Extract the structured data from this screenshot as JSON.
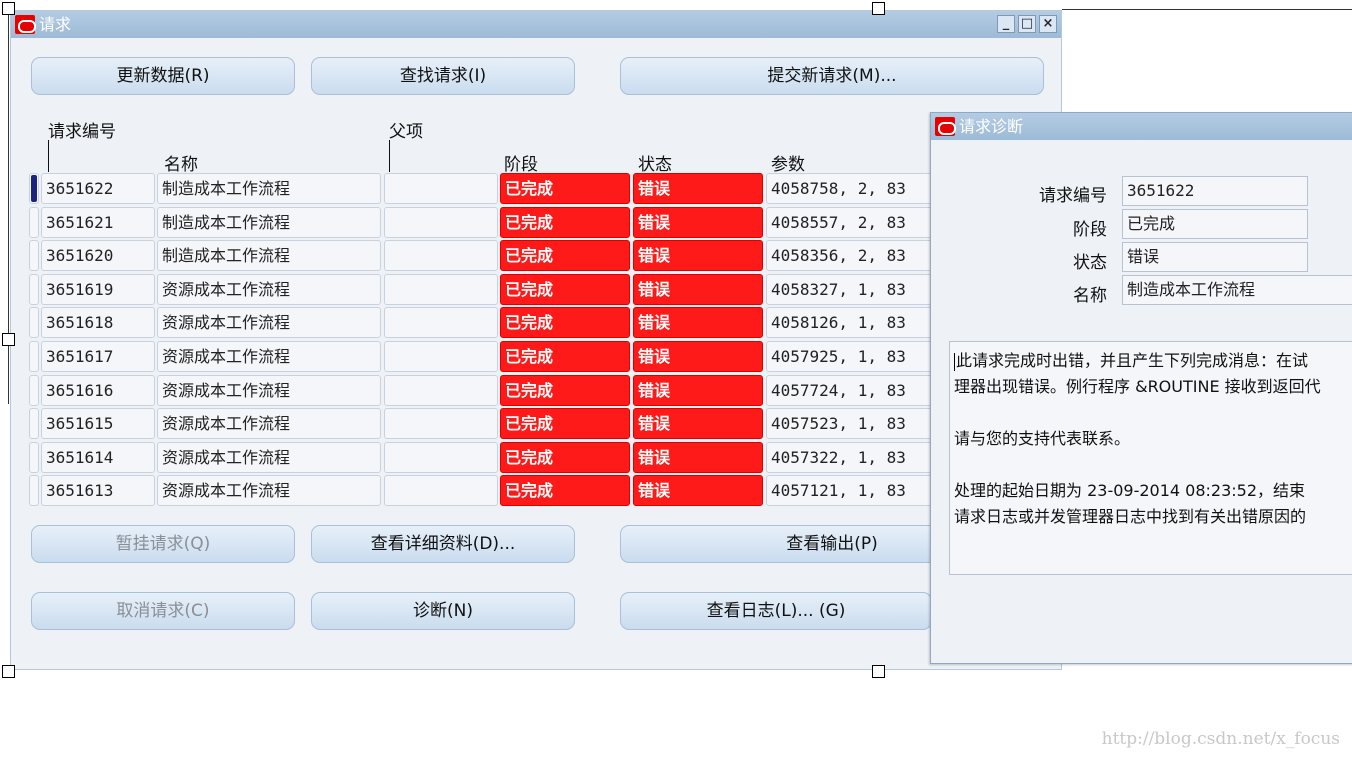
{
  "main_window": {
    "title": "请求",
    "win_buttons": {
      "minimize": "_",
      "maximize": "□",
      "close": "×"
    }
  },
  "toolbar": {
    "refresh_label": "更新数据(R)",
    "find_label": "查找请求(I)",
    "submit_label": "提交新请求(M)..."
  },
  "table": {
    "headers": {
      "request_id": "请求编号",
      "parent": "父项",
      "name": "名称",
      "phase": "阶段",
      "status": "状态",
      "params": "参数"
    },
    "rows": [
      {
        "id": "3651622",
        "name": "制造成本工作流程",
        "parent": "",
        "phase": "已完成",
        "status": "错误",
        "params": "4058758, 2, 83"
      },
      {
        "id": "3651621",
        "name": "制造成本工作流程",
        "parent": "",
        "phase": "已完成",
        "status": "错误",
        "params": "4058557, 2, 83"
      },
      {
        "id": "3651620",
        "name": "制造成本工作流程",
        "parent": "",
        "phase": "已完成",
        "status": "错误",
        "params": "4058356, 2, 83"
      },
      {
        "id": "3651619",
        "name": "资源成本工作流程",
        "parent": "",
        "phase": "已完成",
        "status": "错误",
        "params": "4058327, 1, 83"
      },
      {
        "id": "3651618",
        "name": "资源成本工作流程",
        "parent": "",
        "phase": "已完成",
        "status": "错误",
        "params": "4058126, 1, 83"
      },
      {
        "id": "3651617",
        "name": "资源成本工作流程",
        "parent": "",
        "phase": "已完成",
        "status": "错误",
        "params": "4057925, 1, 83"
      },
      {
        "id": "3651616",
        "name": "资源成本工作流程",
        "parent": "",
        "phase": "已完成",
        "status": "错误",
        "params": "4057724, 1, 83"
      },
      {
        "id": "3651615",
        "name": "资源成本工作流程",
        "parent": "",
        "phase": "已完成",
        "status": "错误",
        "params": "4057523, 1, 83"
      },
      {
        "id": "3651614",
        "name": "资源成本工作流程",
        "parent": "",
        "phase": "已完成",
        "status": "错误",
        "params": "4057322, 1, 83"
      },
      {
        "id": "3651613",
        "name": "资源成本工作流程",
        "parent": "",
        "phase": "已完成",
        "status": "错误",
        "params": "4057121, 1, 83"
      }
    ]
  },
  "actions": {
    "hold_label": "暂挂请求(Q)",
    "details_label": "查看详细资料(D)...",
    "output_label": "查看输出(P)",
    "cancel_label": "取消请求(C)",
    "diagnose_label": "诊断(N)",
    "log_label": "查看日志(L)... (G)"
  },
  "diagnostics": {
    "title": "请求诊断",
    "labels": {
      "request_id": "请求编号",
      "phase": "阶段",
      "status": "状态",
      "name": "名称"
    },
    "values": {
      "request_id": "3651622",
      "phase": "已完成",
      "status": "错误",
      "name": "制造成本工作流程"
    },
    "message": [
      "此请求完成时出错，并且产生下列完成消息：在试",
      "理器出现错误。例行程序 &ROUTINE 接收到返回代",
      "",
      "请与您的支持代表联系。",
      "",
      "处理的起始日期为 23-09-2014 08:23:52，结束",
      "请求日志或并发管理器日志中找到有关出错原因的"
    ]
  },
  "watermark": "http://blog.csdn.net/x_focus",
  "colors": {
    "error": "#ff1a1a",
    "titlebar": "#a7c3dd",
    "selection": "#1a237e"
  }
}
